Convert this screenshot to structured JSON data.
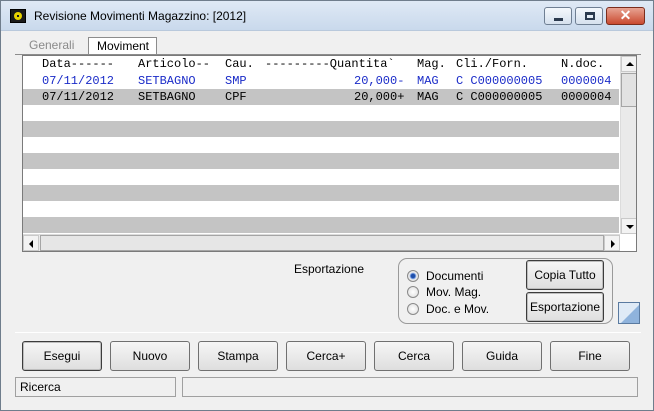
{
  "window": {
    "title": "Revisione Movimenti Magazzino: [2012]",
    "close_glyph": "✕",
    "colors": {
      "accent_blue_text": "#1a2bc8",
      "row_stripe": "#c4c4c4"
    }
  },
  "tabs": [
    {
      "label": "Generali",
      "active": false
    },
    {
      "label": "Moviment",
      "active": true
    }
  ],
  "table": {
    "headers": [
      "Data------",
      "Articolo--",
      "Cau.",
      "---------Quantita`",
      "Mag.",
      "Cli./Forn.",
      "N.doc."
    ],
    "rows": [
      {
        "data": "07/11/2012",
        "articolo": "SETBAGNO",
        "causale": "SMP",
        "quantita": "20,000-",
        "mag": "MAG",
        "cliforn": "C C000000005",
        "ndoc": "0000004",
        "selected": false
      },
      {
        "data": "07/11/2012",
        "articolo": "SETBAGNO",
        "causale": "CPF",
        "quantita": "20,000+",
        "mag": "MAG",
        "cliforn": "C C000000005",
        "ndoc": "0000004",
        "selected": true
      }
    ]
  },
  "export": {
    "label": "Esportazione",
    "options": [
      {
        "label": "Documenti",
        "checked": true
      },
      {
        "label": "Mov. Mag.",
        "checked": false
      },
      {
        "label": "Doc. e Mov.",
        "checked": false
      }
    ],
    "copy_all_label": "Copia Tutto",
    "export_label": "Esportazione"
  },
  "buttons": {
    "esegui": "Esegui",
    "nuovo": "Nuovo",
    "stampa": "Stampa",
    "cerca_plus": "Cerca+",
    "cerca": "Cerca",
    "guida": "Guida",
    "fine": "Fine"
  },
  "statusbar": {
    "left": "Ricerca",
    "right": ""
  }
}
